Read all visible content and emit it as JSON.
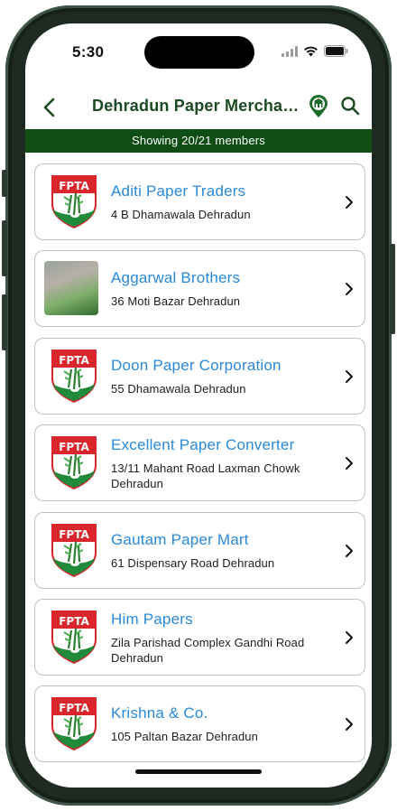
{
  "status_bar": {
    "time": "5:30"
  },
  "header": {
    "title": "Dehradun Paper Merchant...",
    "accent_color": "#1c4a22"
  },
  "banner": {
    "text": "Showing 20/21 members",
    "color": "#0e4d14"
  },
  "logo": {
    "text": "FPTA"
  },
  "members": [
    {
      "name": "Aditi Paper Traders",
      "address": "4 B Dhamawala Dehradun",
      "image": "fpta-logo"
    },
    {
      "name": "Aggarwal Brothers",
      "address": "36 Moti Bazar Dehradun",
      "image": "photo"
    },
    {
      "name": "Doon Paper Corporation",
      "address": "55 Dhamawala Dehradun",
      "image": "fpta-logo"
    },
    {
      "name": "Excellent Paper Converter",
      "address": "13/11 Mahant Road Laxman Chowk Dehradun",
      "image": "fpta-logo"
    },
    {
      "name": "Gautam Paper Mart",
      "address": "61 Dispensary Road Dehradun",
      "image": "fpta-logo"
    },
    {
      "name": "Him Papers",
      "address": "Zila Parishad Complex Gandhi Road Dehradun",
      "image": "fpta-logo"
    },
    {
      "name": "Krishna & Co.",
      "address": "105 Paltan Bazar Dehradun",
      "image": "fpta-logo"
    }
  ],
  "colors": {
    "name_link": "#2a89d8",
    "card_border": "#b9c6bb"
  }
}
